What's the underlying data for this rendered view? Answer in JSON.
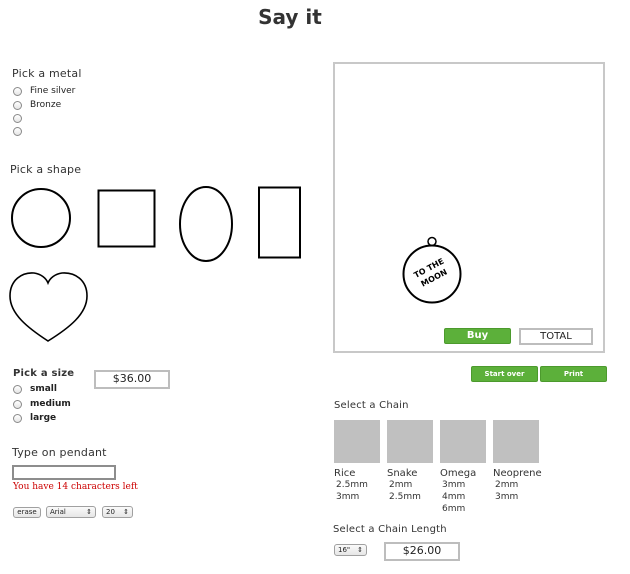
{
  "header": {
    "title": "Say it"
  },
  "metal": {
    "label": "Pick a metal",
    "options": [
      "Fine silver",
      "Bronze",
      "",
      ""
    ]
  },
  "shape": {
    "label": "Pick a shape"
  },
  "size": {
    "label": "Pick a size",
    "options": [
      "small",
      "medium",
      "large"
    ],
    "price": "$36.00"
  },
  "engrave": {
    "label": "Type on pendant",
    "input_value": "",
    "chars_left": "You have 14 characters left",
    "erase_label": "erase",
    "font_value": "Arial",
    "fontsize_value": "20"
  },
  "preview": {
    "pendant_text_line1": "TO THE",
    "pendant_text_line2": "MOON",
    "buy_label": "Buy",
    "total_label": "TOTAL"
  },
  "actions": {
    "start_over_label": "Start over",
    "print_label": "Print"
  },
  "chain": {
    "label": "Select a Chain",
    "items": [
      {
        "name": "Rice",
        "sizes": [
          "2.5mm",
          "3mm"
        ]
      },
      {
        "name": "Snake",
        "sizes": [
          "2mm",
          "2.5mm"
        ]
      },
      {
        "name": "Omega",
        "sizes": [
          "3mm",
          "4mm",
          "6mm"
        ]
      },
      {
        "name": "Neoprene",
        "sizes": [
          "2mm",
          "3mm"
        ]
      }
    ]
  },
  "length": {
    "label": "Select a Chain Length",
    "value": "16\"",
    "price": "$26.00"
  },
  "colors": {
    "accent_green": "#5cb03a",
    "error_red": "#cc0000"
  }
}
